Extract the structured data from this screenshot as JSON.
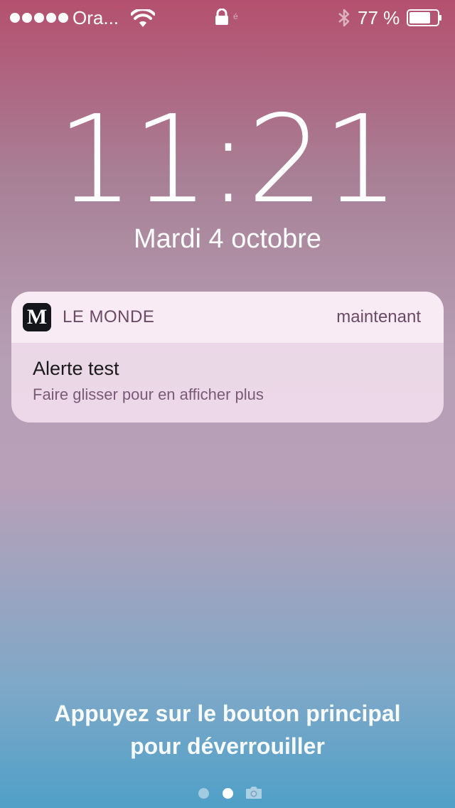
{
  "status_bar": {
    "signal_icon": "signal-dots-icon",
    "carrier": "Ora...",
    "wifi_icon": "wifi-icon",
    "lock_icon": "lock-icon",
    "lock_mark": "é",
    "bluetooth_icon": "bluetooth-icon",
    "battery_text": "77 %",
    "battery_level": 0.77,
    "battery_icon": "battery-icon"
  },
  "lock_screen": {
    "time": "11:21",
    "date": "Mardi 4 octobre"
  },
  "notification": {
    "app_icon_letter": "M",
    "app_name": "LE MONDE",
    "time": "maintenant",
    "title": "Alerte test",
    "body": "Faire glisser pour en afficher plus"
  },
  "unlock_hint": {
    "line1": "Appuyez sur le bouton principal",
    "line2": "pour déverrouiller"
  },
  "page_indicator": {
    "pages": 2,
    "current_index": 1,
    "camera_icon": "camera-icon"
  },
  "colors": {
    "gradient_top": "#b4506f",
    "gradient_bottom": "#4fa0c8",
    "notification_bg": "#f0dceb",
    "notification_meta": "#6b4a66"
  }
}
